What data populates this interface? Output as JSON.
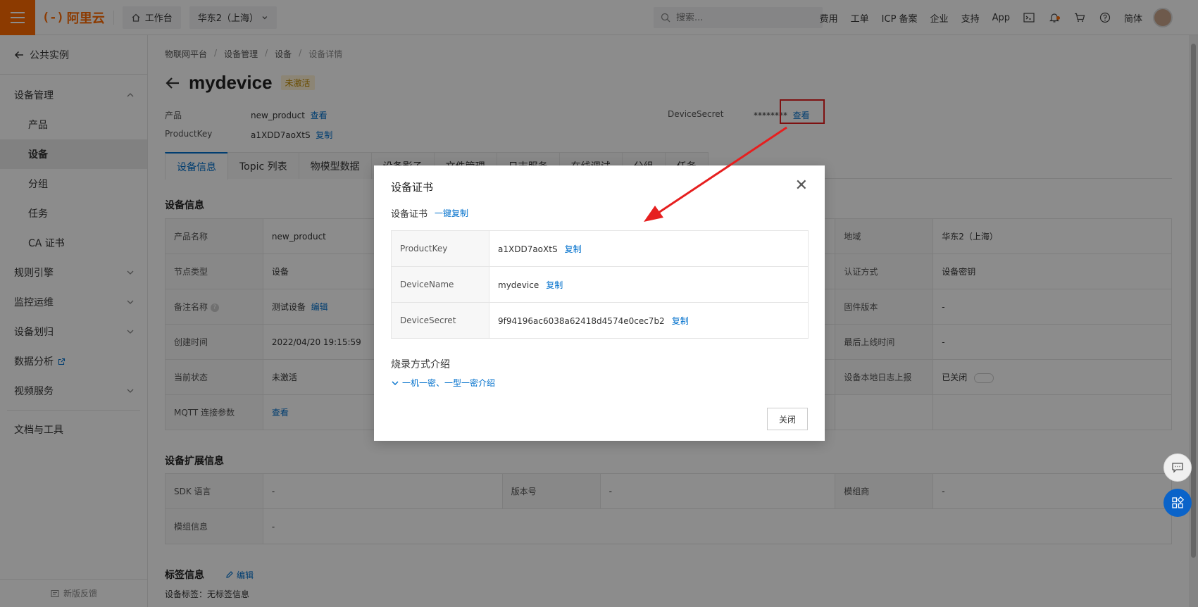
{
  "topbar": {
    "brand": "阿里云",
    "workbench": "工作台",
    "region": "华东2（上海）",
    "search_placeholder": "搜索...",
    "links": [
      "费用",
      "工单",
      "ICP 备案",
      "企业",
      "支持",
      "App"
    ],
    "language": "简体"
  },
  "sidebar": {
    "back_label": "公共实例",
    "group_device_mgmt": "设备管理",
    "items": [
      "产品",
      "设备",
      "分组",
      "任务",
      "CA 证书"
    ],
    "active_item": "设备",
    "groups": [
      "规则引擎",
      "监控运维",
      "设备划归",
      "数据分析",
      "视频服务"
    ],
    "docs": "文档与工具",
    "feedback": "新版反馈"
  },
  "breadcrumb": [
    "物联网平台",
    "设备管理",
    "设备",
    "设备详情"
  ],
  "device": {
    "name": "mydevice",
    "status_badge": "未激活",
    "product_label": "产品",
    "product_value": "new_product",
    "view_link": "查看",
    "productkey_label": "ProductKey",
    "productkey_value": "a1XDD7aoXtS",
    "copy_link": "复制",
    "secret_label": "DeviceSecret",
    "secret_masked": "********",
    "secret_view": "查看"
  },
  "tabs": [
    "设备信息",
    "Topic 列表",
    "物模型数据",
    "设备影子",
    "文件管理",
    "日志服务",
    "在线调试",
    "分组",
    "任务"
  ],
  "info_section": {
    "title": "设备信息",
    "rows": [
      {
        "k1": "产品名称",
        "v1": "new_product",
        "k3": "地域",
        "v3": "华东2（上海）"
      },
      {
        "k1": "节点类型",
        "v1": "设备",
        "k3": "认证方式",
        "v3": "设备密钥"
      },
      {
        "k1": "备注名称",
        "v1": "测试设备",
        "v1_link": "编辑",
        "k3": "固件版本",
        "v3": "-"
      },
      {
        "k1": "创建时间",
        "v1": "2022/04/20 19:15:59",
        "k3": "最后上线时间",
        "v3": "-"
      },
      {
        "k1": "当前状态",
        "v1": "未激活",
        "k3": "设备本地日志上报",
        "v3": "已关闭"
      },
      {
        "k1": "MQTT 连接参数",
        "v1_link": "查看"
      }
    ]
  },
  "ext_section": {
    "title": "设备扩展信息",
    "sdk_label": "SDK 语言",
    "sdk_value": "-",
    "version_label": "版本号",
    "version_value": "-",
    "vendor_label": "模组商",
    "vendor_value": "-",
    "module_label": "模组信息",
    "module_value": "-"
  },
  "tag_section": {
    "title": "标签信息",
    "edit": "编辑",
    "tags_label": "设备标签：",
    "tags_value": "无标签信息"
  },
  "modal": {
    "title": "设备证书",
    "subtitle": "设备证书",
    "copy_all": "一键复制",
    "rows": [
      {
        "k": "ProductKey",
        "v": "a1XDD7aoXtS",
        "copy": "复制"
      },
      {
        "k": "DeviceName",
        "v": "mydevice",
        "copy": "复制"
      },
      {
        "k": "DeviceSecret",
        "v": "9f94196ac6038a62418d4574e0cec7b2",
        "copy": "复制"
      }
    ],
    "burn_title": "烧录方式介绍",
    "burn_link": "一机一密、一型一密介绍",
    "close_button": "关闭"
  },
  "colors": {
    "brand_orange": "#ff6a00",
    "link_blue": "#0070cc",
    "highlight_red": "#e61f1f"
  }
}
